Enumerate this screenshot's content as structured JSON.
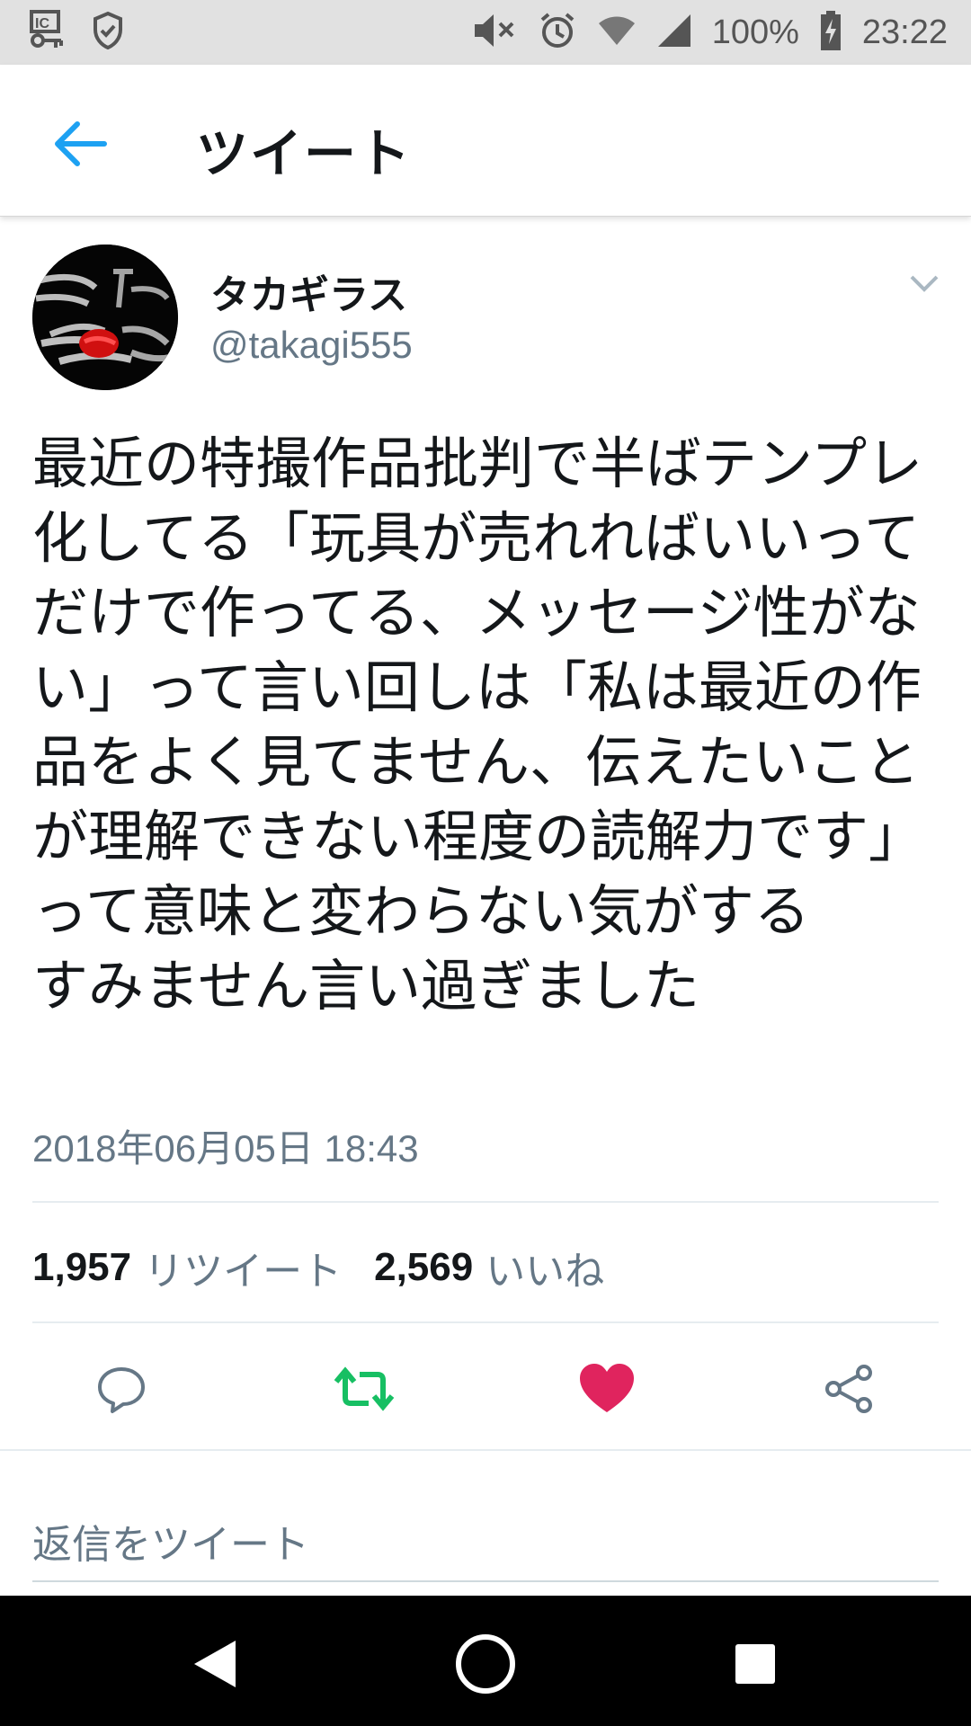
{
  "status_bar": {
    "battery_percent": "100%",
    "time": "23:22",
    "icons": [
      "vpn-key-icon",
      "shield-icon",
      "mute-icon",
      "alarm-icon",
      "wifi-icon",
      "signal-icon",
      "battery-charging-icon"
    ]
  },
  "header": {
    "back_icon": "arrow-left-icon",
    "title": "ツイート"
  },
  "tweet": {
    "display_name": "タカギラス",
    "handle": "@takagi555",
    "text": "最近の特撮作品批判で半ばテンプレ化してる「玩具が売れればいいってだけで作ってる、メッセージ性がない」って言い回しは「私は最近の作品をよく見てません、伝えたいことが理解できない程度の読解力です」って意味と変わらない気がする\nすみません言い過ぎました",
    "timestamp": "2018年06月05日 18:43",
    "retweet_count": "1,957",
    "retweet_label": "リツイート",
    "like_count": "2,569",
    "like_label": "いいね"
  },
  "actions": [
    "reply-icon",
    "retweet-icon",
    "like-icon",
    "share-icon"
  ],
  "reply_placeholder": "返信をツイート",
  "colors": {
    "accent": "#1da1f2",
    "retweet": "#17bf63",
    "like": "#e0245e",
    "secondary_text": "#657786"
  }
}
